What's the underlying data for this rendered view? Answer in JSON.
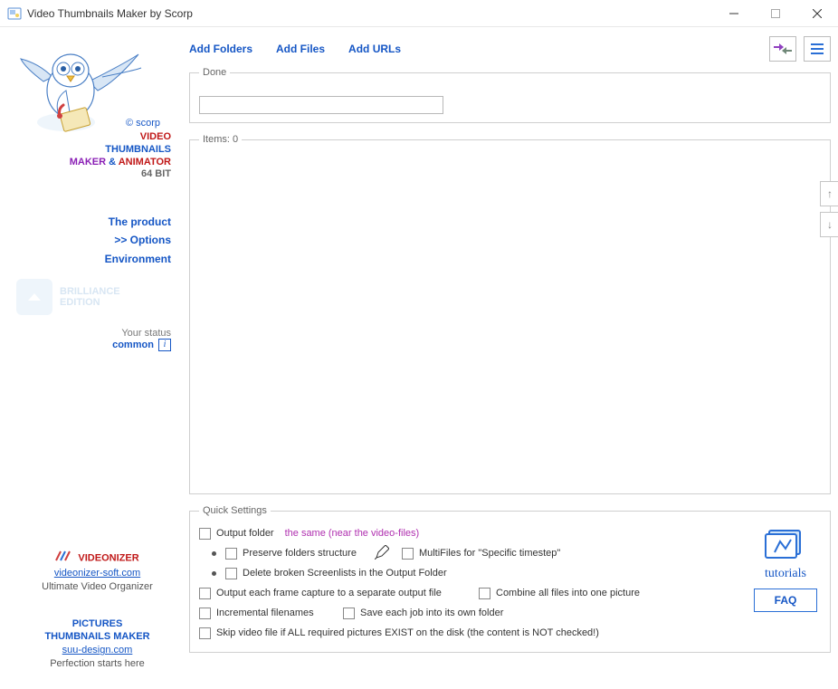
{
  "window": {
    "title": "Video Thumbnails Maker by Scorp"
  },
  "sidebar": {
    "scorp": "© scorp",
    "brand": {
      "video": "VIDEO",
      "thumbnails": "THUMBNAILS",
      "maker": "MAKER",
      "amp": " & ",
      "animator": "ANIMATOR",
      "bit": "64 BIT"
    },
    "nav": {
      "product": "The product",
      "options": ">> Options",
      "env": "Environment"
    },
    "edition": {
      "line1": "BRILLIANCE",
      "line2": "EDITION"
    },
    "status": {
      "label": "Your status",
      "value": "common"
    },
    "videonizer": {
      "heading": "VIDEONIZER",
      "link": "videonizer-soft.com",
      "sub": "Ultimate Video Organizer"
    },
    "ptm": {
      "line1": "PICTURES",
      "line2": "THUMBNAILS MAKER",
      "link": "suu-design.com",
      "sub": "Perfection starts here"
    }
  },
  "toolbar": {
    "add_folders": "Add Folders",
    "add_files": "Add Files",
    "add_urls": "Add URLs"
  },
  "done": {
    "legend": "Done"
  },
  "items": {
    "legend": "Items: 0"
  },
  "quick": {
    "legend": "Quick Settings",
    "output_folder": "Output folder",
    "output_folder_val": "the same (near the video-files)",
    "preserve": "Preserve folders structure",
    "multifiles": "MultiFiles for \"Specific timestep\"",
    "delete_broken": "Delete broken Screenlists in the Output Folder",
    "each_frame": "Output each frame capture to a separate output file",
    "combine": "Combine all files into one picture",
    "incremental": "Incremental filenames",
    "save_each": "Save each job into its own folder",
    "skip": "Skip video file if ALL required pictures EXIST on the disk (the content is NOT checked!)"
  },
  "tutorials": {
    "label": "tutorials",
    "faq": "FAQ"
  }
}
